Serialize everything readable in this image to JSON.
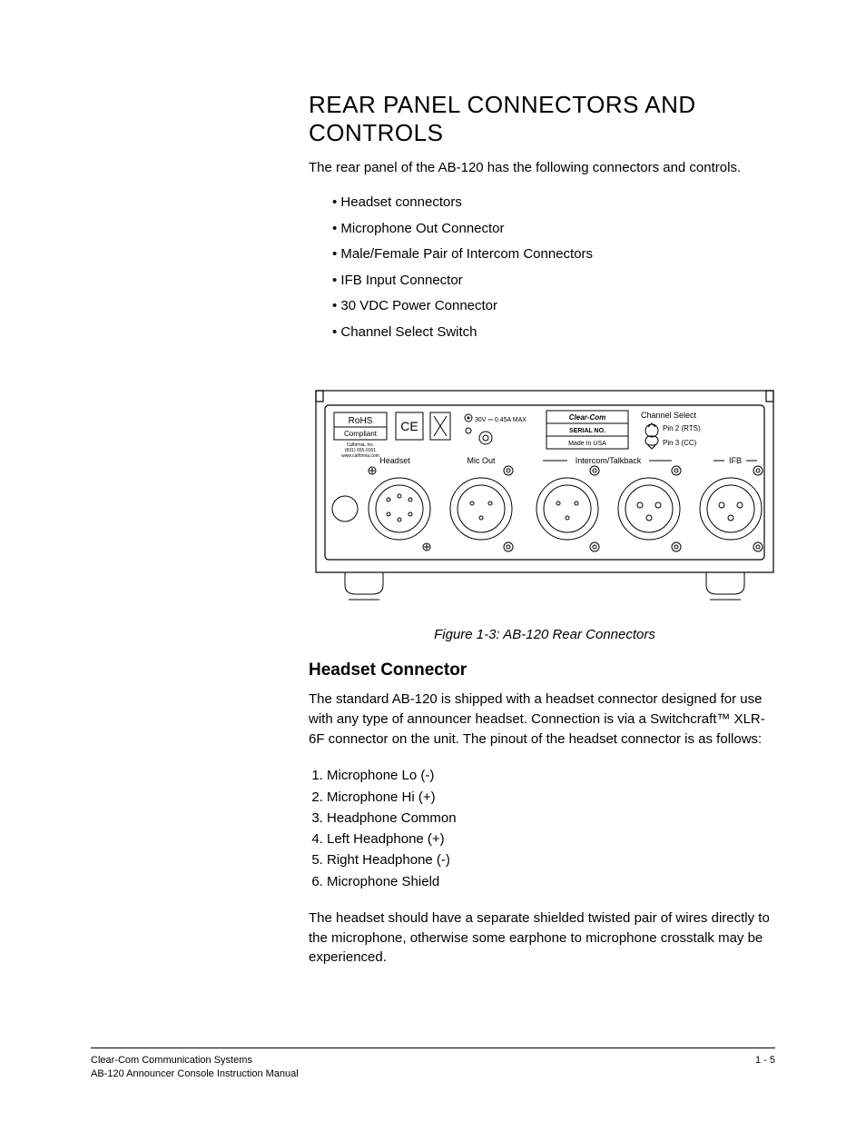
{
  "heading": "REAR PANEL CONNECTORS AND CONTROLS",
  "intro": "The rear panel of the AB-120 has the following connectors and controls.",
  "bullets": [
    "Headset connectors",
    "Microphone Out Connector",
    "Male/Female Pair of Intercom Connectors",
    "IFB Input Connector",
    "30 VDC Power Connector",
    "Channel Select Switch"
  ],
  "figure": {
    "caption": "Figure 1-3: AB-120 Rear Connectors",
    "labels": {
      "rohs_top": "RoHS",
      "rohs_bottom": "Compliant",
      "rohs_sub1": "Calfornia, Inc.",
      "rohs_sub2": "(831) 655-0151",
      "rohs_sub3": "www.calfornia.com",
      "ce": "CE",
      "power_spec": "30V ⎓ 0.45A MAX",
      "brand": "Clear-Com",
      "serial": "SERIAL NO.",
      "made_in": "Made In USA",
      "channel_select": "Channel Select",
      "pin2": "Pin 2 (RTS)",
      "pin3": "Pin 3 (CC)",
      "headset": "Headset",
      "mic_out": "Mic Out",
      "intercom": "Intercom/Talkback",
      "ifb": "IFB"
    }
  },
  "section1": {
    "title": "Headset Connector",
    "p1": "The standard AB-120 is shipped with a headset connector designed for use with any type of announcer headset.  Connection is via a Switchcraft™ XLR-6F connector on the unit. The pinout of the headset connector is as follows:",
    "pinout": [
      "Microphone Lo (-)",
      "Microphone Hi (+)",
      "Headphone Common",
      "Left Headphone (+)",
      "Right Headphone (-)",
      "Microphone Shield"
    ],
    "p2": "The headset should have a separate shielded twisted pair of wires directly to the microphone, otherwise some earphone to microphone crosstalk may be experienced."
  },
  "footer": {
    "line1": "Clear-Com Communication Systems",
    "line2": "AB-120 Announcer Console Instruction Manual",
    "page": "1 - 5"
  }
}
